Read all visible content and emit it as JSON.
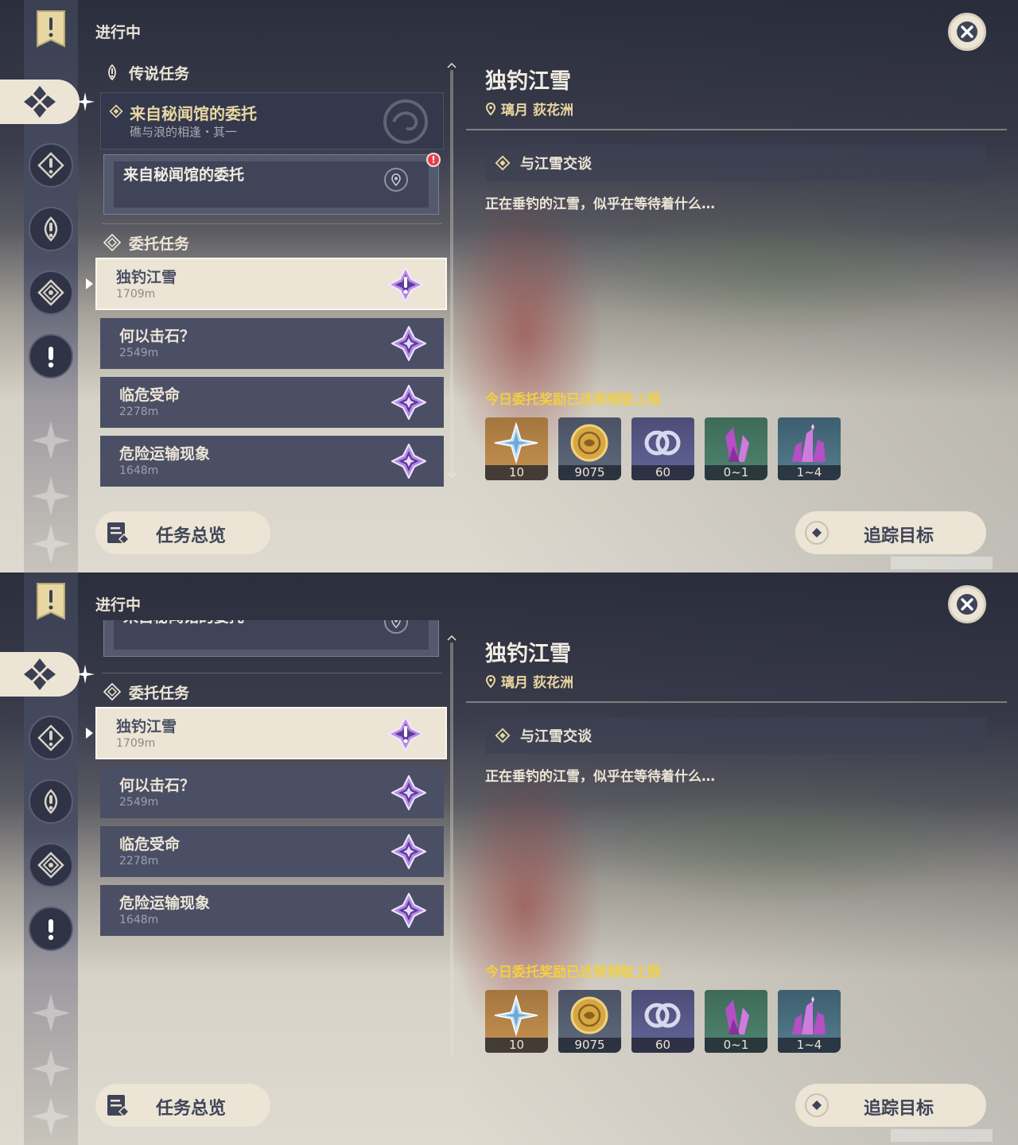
{
  "panel": {
    "in_progress": "进行中"
  },
  "legend_category": {
    "label": "传说任务"
  },
  "legend_quest": {
    "title": "来自秘闻馆的委托",
    "subtitle": "礁与浪的相逢・其一"
  },
  "legend_subquest": {
    "title": "来自秘闻馆的委托",
    "alert": "!"
  },
  "commission_category": {
    "label": "委托任务"
  },
  "quests": [
    {
      "name": "独钓江雪",
      "distance": "1709m"
    },
    {
      "name": "何以击石？",
      "distance": "2549m"
    },
    {
      "name": "临危受命",
      "distance": "2278m"
    },
    {
      "name": "危险运输现象",
      "distance": "1648m"
    }
  ],
  "detail": {
    "title": "独钓江雪",
    "region": "璃月",
    "area": "荻花洲",
    "objective": "与江雪交谈",
    "description": "正在垂钓的江雪，似乎在等待着什么…",
    "reward_notice": "今日委托奖励已达到领取上限"
  },
  "rewards": [
    {
      "icon": "primogem-icon",
      "count": "10"
    },
    {
      "icon": "mora-icon",
      "count": "9075"
    },
    {
      "icon": "exp-icon",
      "count": "60"
    },
    {
      "icon": "gem-fragment-icon",
      "count": "0~1"
    },
    {
      "icon": "gem-sliver-icon",
      "count": "1~4"
    }
  ],
  "buttons": {
    "overview": "任务总览",
    "track": "追踪目标"
  },
  "colors": {
    "accent_gold": "#e8d7a2",
    "notice_yellow": "#f3cf3f",
    "panel_cream": "#ece5d5",
    "row_slate": "#4a4f65",
    "alert_red": "#e2414a"
  }
}
